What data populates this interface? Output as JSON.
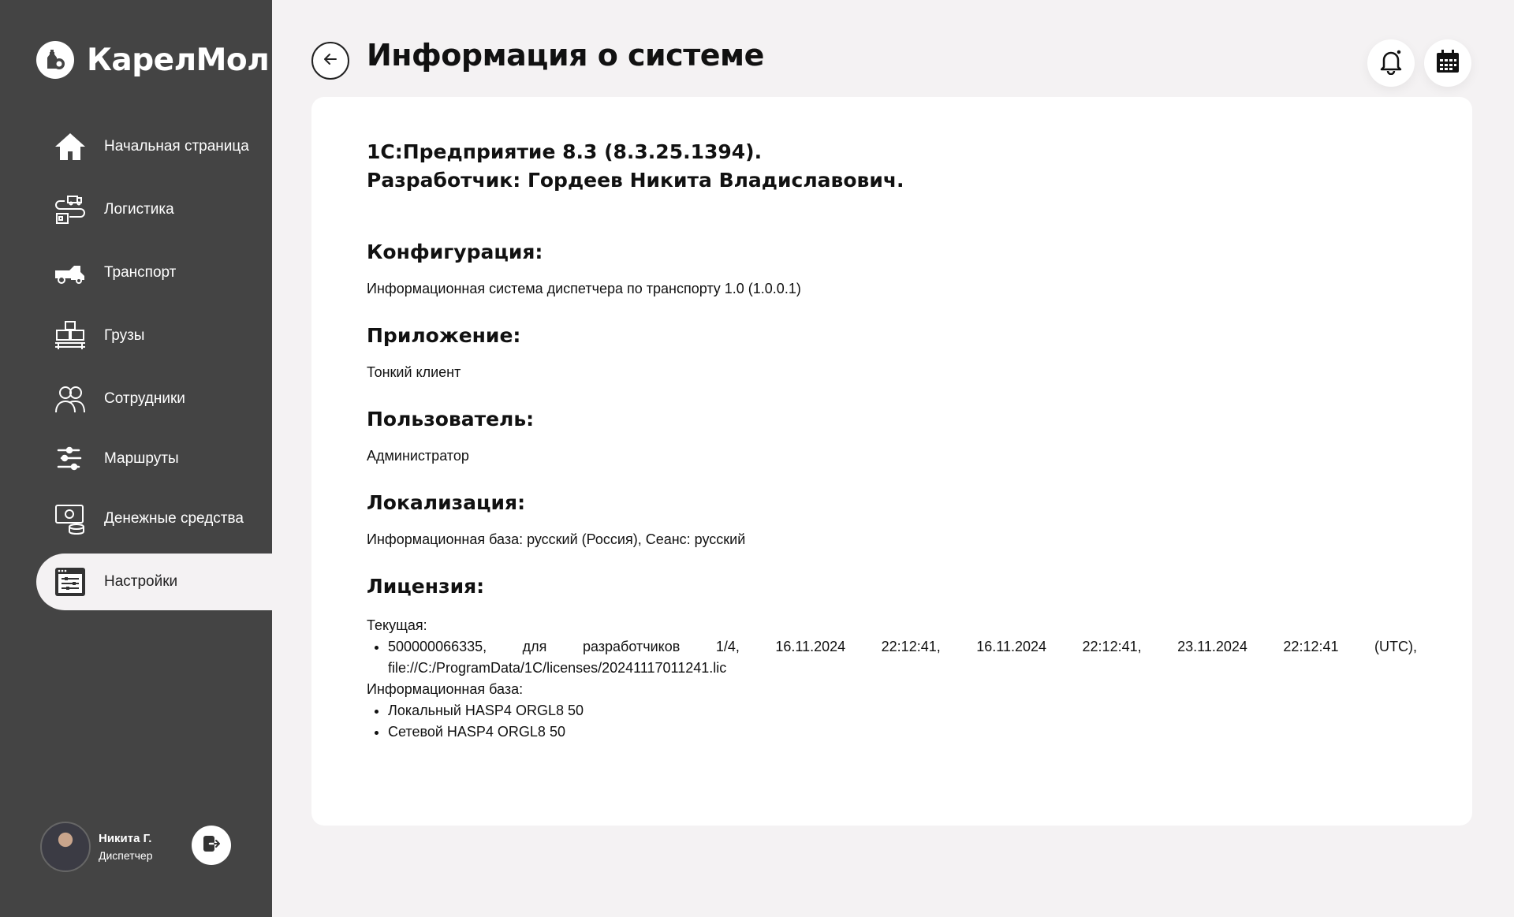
{
  "app": {
    "name": "КарелМол"
  },
  "sidebar": {
    "items": [
      {
        "label": "Начальная страница",
        "icon": "home-icon"
      },
      {
        "label": "Логистика",
        "icon": "logistics-icon"
      },
      {
        "label": "Транспорт",
        "icon": "transport-icon"
      },
      {
        "label": "Грузы",
        "icon": "cargo-icon"
      },
      {
        "label": "Сотрудники",
        "icon": "employees-icon"
      },
      {
        "label": "Маршруты",
        "icon": "routes-icon"
      },
      {
        "label": "Денежные средства",
        "icon": "money-icon"
      },
      {
        "label": "Настройки",
        "icon": "settings-icon",
        "active": true
      }
    ]
  },
  "user": {
    "name": "Никита Г.",
    "role": "Диспетчер"
  },
  "header": {
    "title": "Информация о системе"
  },
  "info": {
    "platform": "1С:Предприятие 8.3 (8.3.25.1394).",
    "developer": "Разработчик: Гордеев Никита Владиславович.",
    "configuration_title": "Конфигурация:",
    "configuration_value": "Информационная система диспетчера по транспорту 1.0 (1.0.0.1)",
    "application_title": "Приложение:",
    "application_value": "Тонкий клиент",
    "user_title": "Пользователь:",
    "user_value": "Администратор",
    "localization_title": "Локализация:",
    "localization_value": "Информационная база: русский (Россия), Сеанс: русский",
    "license_title": "Лицензия:",
    "license_current_label": "Текущая:",
    "license_current_items": [
      "500000066335, для разработчиков 1/4, 16.11.2024 22:12:41, 16.11.2024 22:12:41, 23.11.2024 22:12:41 (UTC), file://C:/ProgramData/1C/licenses/20241117011241.lic"
    ],
    "license_db_label": "Информационная база:",
    "license_db_items": [
      "Локальный HASP4 ORGL8 50",
      "Сетевой HASP4 ORGL8 50"
    ]
  },
  "colors": {
    "sidebar": "#444444",
    "background": "#f4f2f3",
    "card": "#ffffff"
  }
}
